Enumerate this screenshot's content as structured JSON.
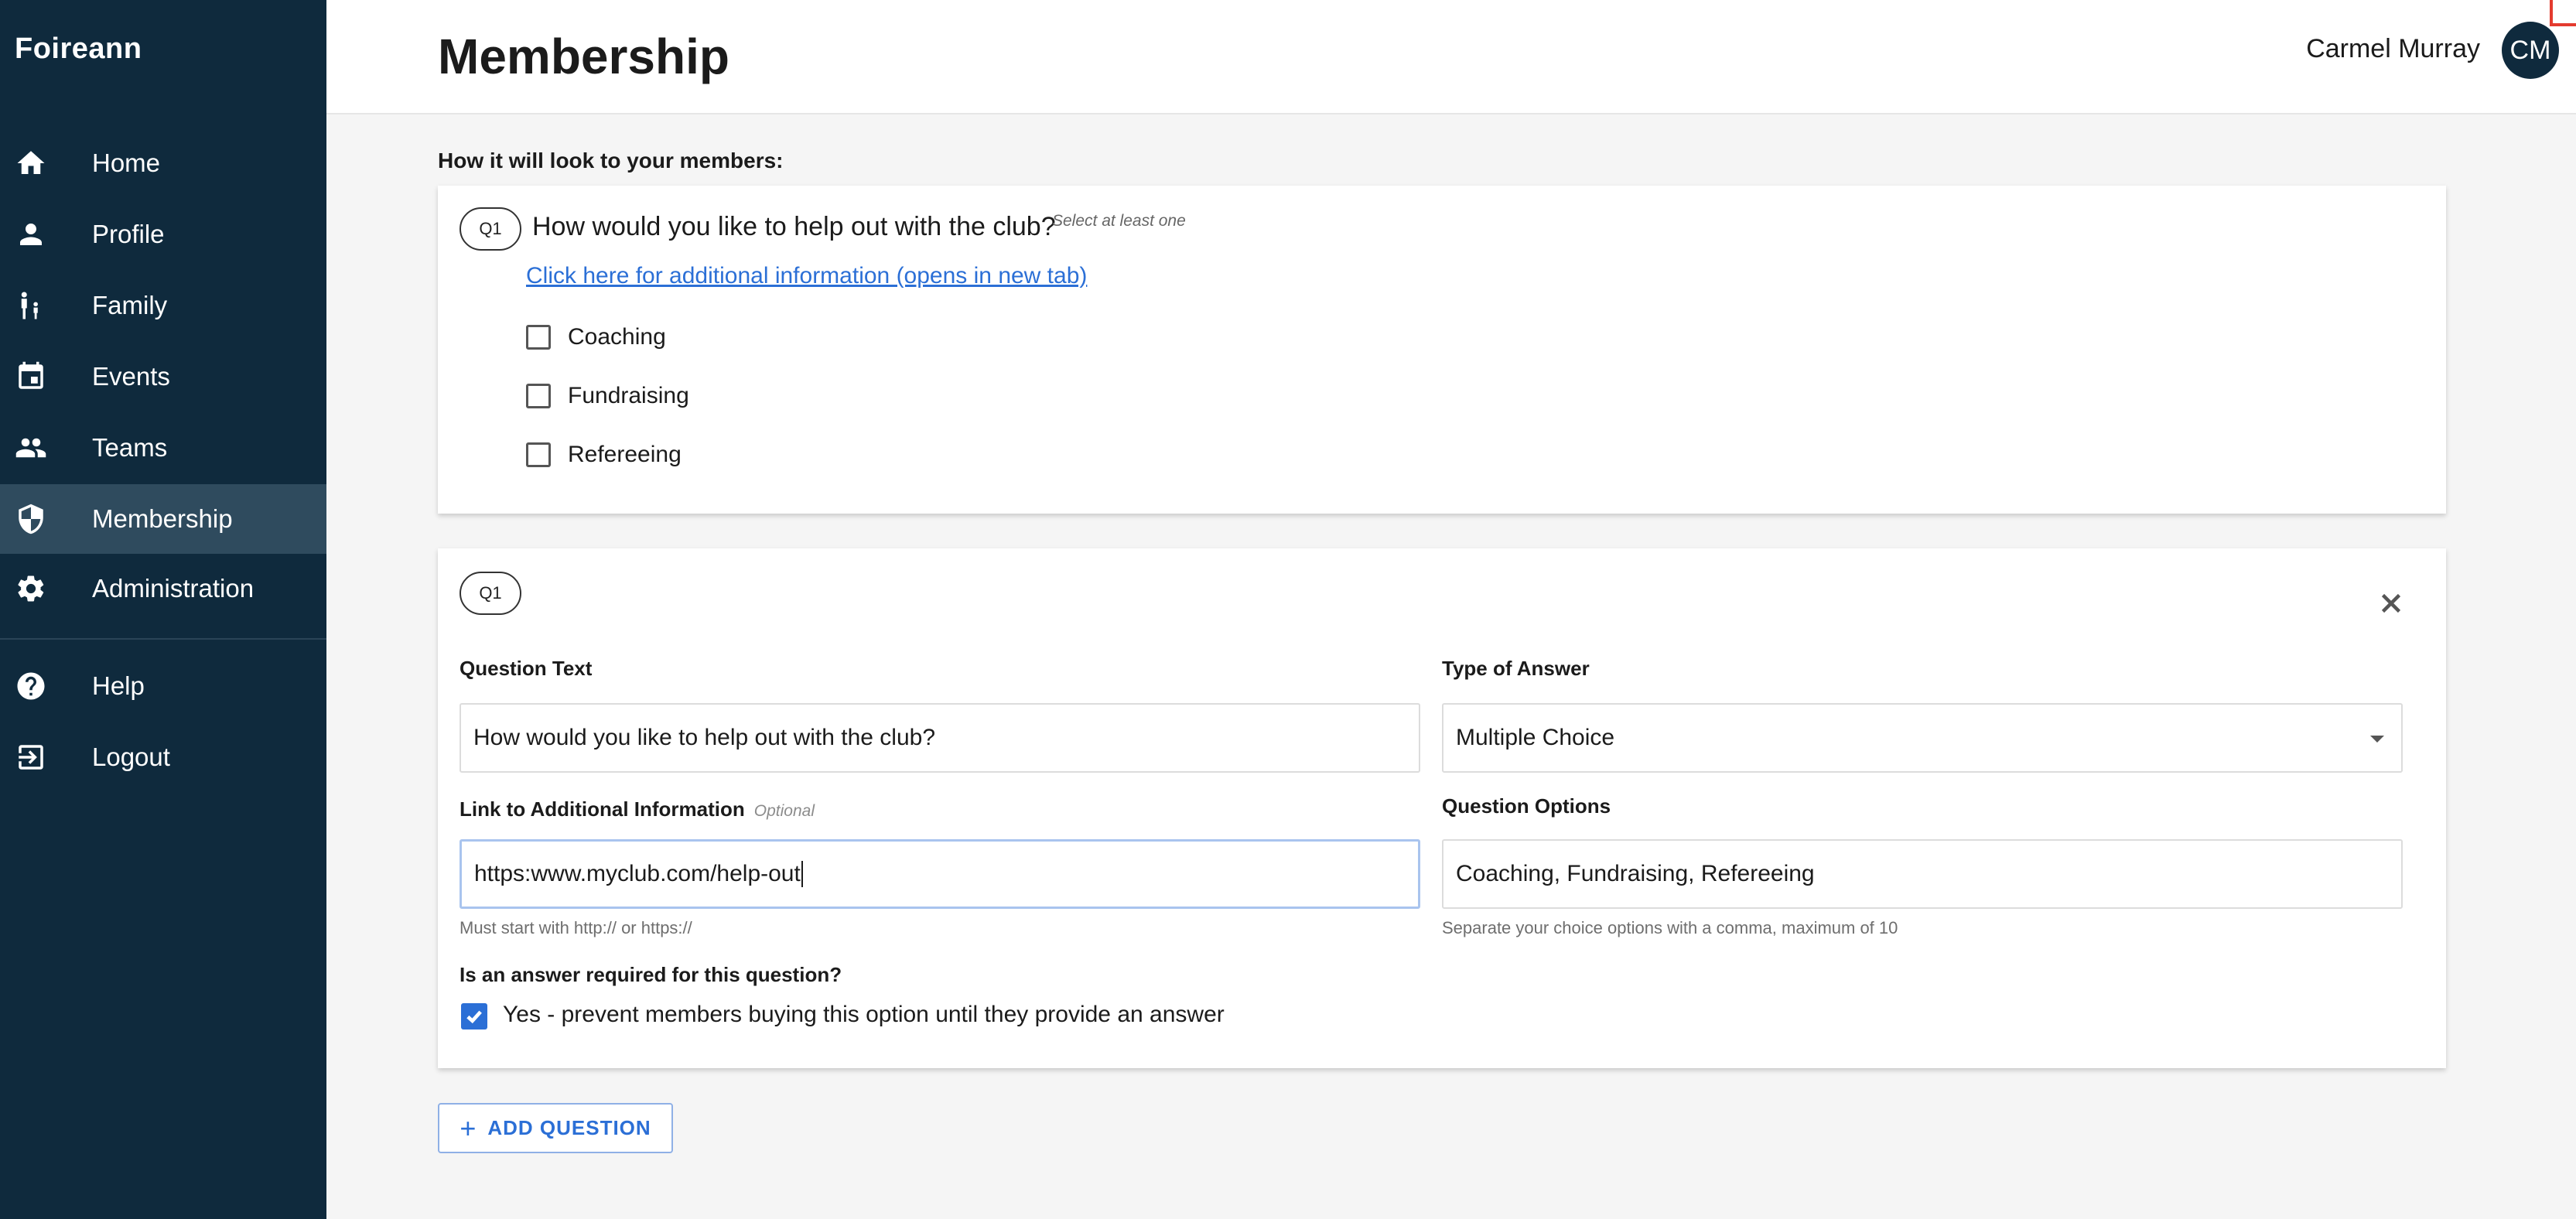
{
  "app": {
    "brand": "Foireann"
  },
  "sidebar": {
    "items": [
      {
        "label": "Home",
        "icon": "home-icon"
      },
      {
        "label": "Profile",
        "icon": "person-icon"
      },
      {
        "label": "Family",
        "icon": "family-icon"
      },
      {
        "label": "Events",
        "icon": "calendar-icon"
      },
      {
        "label": "Teams",
        "icon": "group-icon"
      },
      {
        "label": "Membership",
        "icon": "shield-icon",
        "active": true
      },
      {
        "label": "Administration",
        "icon": "gear-icon"
      }
    ],
    "bottom_items": [
      {
        "label": "Help",
        "icon": "help-icon"
      },
      {
        "label": "Logout",
        "icon": "logout-icon"
      }
    ]
  },
  "header": {
    "title": "Membership",
    "user_name": "Carmel Murray",
    "avatar_initials": "CM"
  },
  "preview": {
    "heading": "How it will look to your members:",
    "badge": "Q1",
    "question": "How would you like to help out with the club?",
    "hint": "Select at least one",
    "link_text": "Click here for additional information (opens in new tab)",
    "options": [
      "Coaching",
      "Fundraising",
      "Refereeing"
    ]
  },
  "editor": {
    "badge": "Q1",
    "question_text_label": "Question Text",
    "question_text_value": "How would you like to help out with the club?",
    "answer_type_label": "Type of Answer",
    "answer_type_value": "Multiple Choice",
    "link_label": "Link to Additional Information",
    "link_optional": "Optional",
    "link_value": "https:www.myclub.com/help-out",
    "link_helper": "Must start with http:// or https://",
    "options_label": "Question Options",
    "options_value": "Coaching, Fundraising, Refereeing",
    "options_helper": "Separate your choice options with a comma, maximum of 10",
    "required_label": "Is an answer required for this question?",
    "required_checked": true,
    "required_text": "Yes - prevent members buying this option until they provide an answer"
  },
  "actions": {
    "add_question": "ADD QUESTION"
  },
  "colors": {
    "sidebar": "#0f2a3d",
    "sidebar_active": "#2f4b5e",
    "accent": "#2b6fd6"
  }
}
